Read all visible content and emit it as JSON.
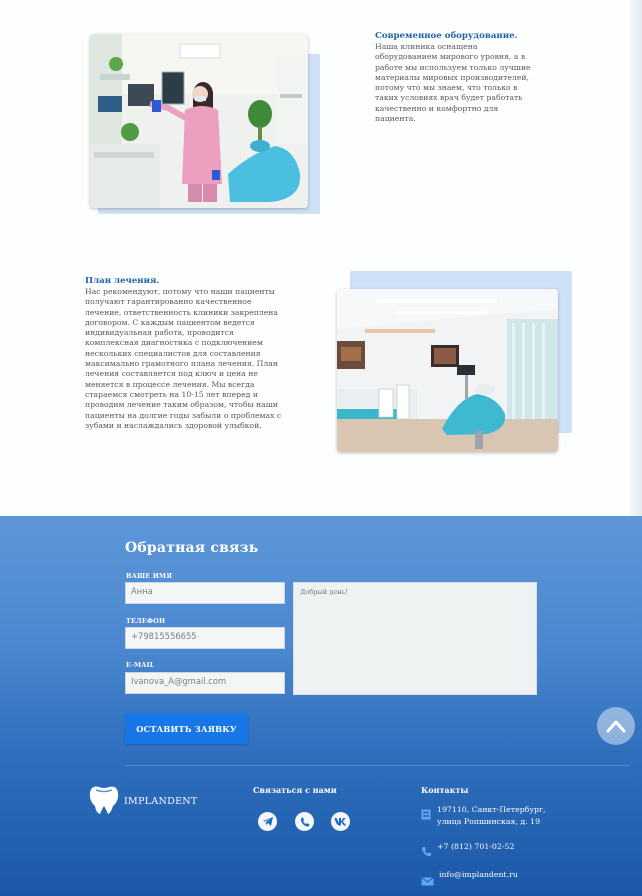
{
  "features": [
    {
      "title": "Современное оборудование.",
      "lines": [
        "Наша клиника оснащена",
        "оборудованием мирового уровня, а в",
        "работе мы используем только лучшие",
        "материалы мировых производителей,",
        "потому что мы знаем, что только в",
        "таких условиях врач будет работать",
        "качественно и комфортно для",
        "пациента."
      ],
      "photo": "doctor-with-xray-photo"
    },
    {
      "title": "План лечения.",
      "lines": [
        "Нас рекомендуют, потому что наши пациенты",
        "получают гарантированно качественное",
        "лечение, ответственность клиники закреплена",
        "договором. С каждым пациентом ведется",
        "индивидуальная работа, проводится",
        "комплексная диагностика с подключением",
        "нескольких специалистов для составления",
        "максимально грамотного плана лечения. План",
        "лечения составляется под ключ и цена не",
        "меняется в процессе лечения. Мы всегда",
        "стараемся смотреть на 10-15 лет вперед и",
        "проводим лечение таким образом, чтобы наши",
        "пациенты на долгие годы забыли о проблемах с",
        "зубами и наслаждались здоровой улыбкой."
      ],
      "photo": "dental-office-photo"
    }
  ],
  "form": {
    "title": "Обратная связь",
    "name_label": "ВАШЕ ИМЯ",
    "name_value": "Анна",
    "phone_label": "ТЕЛЕФОН",
    "phone_value": "+79815556655",
    "email_label": "E-MAIL",
    "email_value": "Ivanova_A@gmail.com",
    "message_value": "Добрый день!",
    "submit_label": "ОСТАВИТЬ ЗАЯВКУ"
  },
  "footer": {
    "logo_text": "IMPLANDENT",
    "contact_us_title": "Связаться с нами",
    "socials": [
      "telegram-icon",
      "whatsapp-icon",
      "vk-icon"
    ],
    "contacts_title": "Контакты",
    "address_line1": "197110, Санкт-Петербург,",
    "address_line2": "улица Ропшинская, д. 19",
    "phone": "+7 (812) 701-02-52",
    "email": "info@implandent.ru"
  },
  "colors": {
    "accent": "#1877e6",
    "heading": "#1f62a8",
    "footer_top": "#5d97d8",
    "footer_bottom": "#1b58a8"
  }
}
